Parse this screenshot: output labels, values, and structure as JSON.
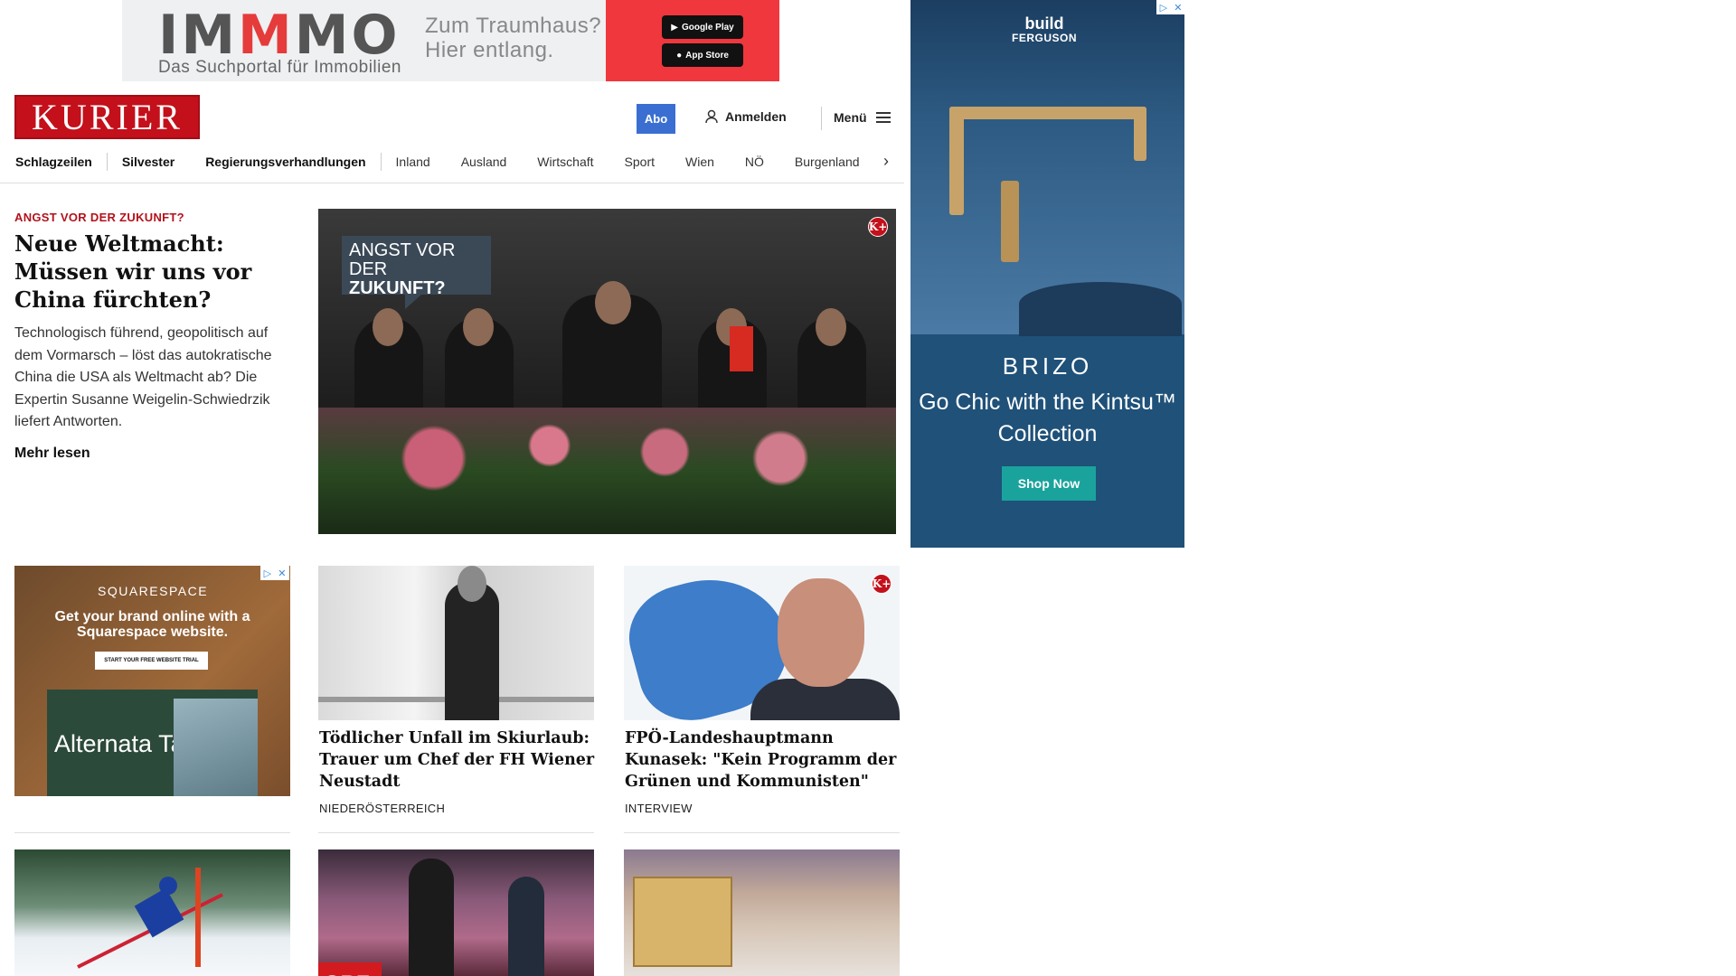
{
  "top_ad": {
    "logo_gray_a": "IM",
    "logo_red": "M",
    "logo_gray_b": "MO",
    "subtitle": "Das Suchportal für Immobilien",
    "tagline_1": "Zum Traumhaus?",
    "tagline_2": "Hier entlang.",
    "google_play": "Google Play",
    "app_store": "App Store"
  },
  "header": {
    "brand": "KURIER",
    "abo": "Abo",
    "login": "Anmelden",
    "menu": "Menü"
  },
  "nav": {
    "items": [
      "Schlagzeilen",
      "Silvester",
      "Regierungsverhandlungen",
      "Inland",
      "Ausland",
      "Wirtschaft",
      "Sport",
      "Wien",
      "NÖ",
      "Burgenland"
    ]
  },
  "lead": {
    "kicker": "ANGST VOR DER ZUKUNFT?",
    "title": "Neue Weltmacht: Müssen wir uns vor China fürchten?",
    "text": "Technologisch führend, geopolitisch auf dem Vormarsch – löst das autokratische China die USA als Weltmacht ab? Die Expertin Susanne Weigelin-Schwiedrzik liefert Antworten.",
    "more": "Mehr lesen",
    "image_bubble_1": "ANGST VOR DER",
    "image_bubble_2": "ZUKUNFT?"
  },
  "side_ad": {
    "top_brand_1": "build",
    "top_brand_2": "FERGUSON",
    "brand": "BRIZO",
    "tagline": "Go Chic with the Kintsu™ Collection",
    "cta": "Shop Now"
  },
  "square_ad": {
    "brand": "SQUARESPACE",
    "headline": "Get your brand online with a Squarespace website.",
    "cta": "START YOUR FREE WEBSITE TRIAL",
    "panel_text": "Alternata Tailors"
  },
  "cards": [
    {
      "title": "Tödlicher Unfall im Skiurlaub: Trauer um Chef der FH Wiener Neustadt",
      "label": "NIEDERÖSTERREICH"
    },
    {
      "title": "FPÖ-Landeshauptmann Kunasek: \"Kein Programm der Grünen und Kommunisten\"",
      "label": "INTERVIEW"
    }
  ],
  "bottom_row": {
    "orf_text": "ORF"
  },
  "premium_badge": "K+",
  "colors": {
    "brand_red": "#c3101b",
    "abo_blue": "#3a6fd1",
    "shop_teal": "#19a39c"
  }
}
